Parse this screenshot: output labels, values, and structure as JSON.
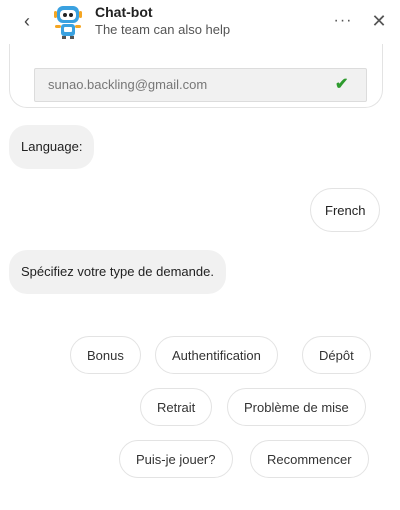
{
  "header": {
    "back_icon": "chevron-left-icon",
    "back_glyph": "‹",
    "title": "Chat-bot",
    "subtitle": "The team can also help",
    "more_glyph": "···",
    "close_glyph": "✕"
  },
  "email": {
    "value": "sunao.backling@gmail.com",
    "check_glyph": "✔",
    "check_color": "#2e9b2e"
  },
  "messages": {
    "language_prompt": "Language:",
    "user_language": "French",
    "type_prompt": "Spécifiez votre type de demande."
  },
  "quick_replies": {
    "bonus": "Bonus",
    "authentification": "Authentification",
    "depot": "Dépôt",
    "retrait": "Retrait",
    "probleme": "Problème de mise",
    "puis_je": "Puis-je jouer?",
    "recommencer": "Recommencer"
  },
  "colors": {
    "bubble_bg": "#f1f1f1",
    "border": "#e3e3e3",
    "accent_blue": "#3aa1e0"
  }
}
